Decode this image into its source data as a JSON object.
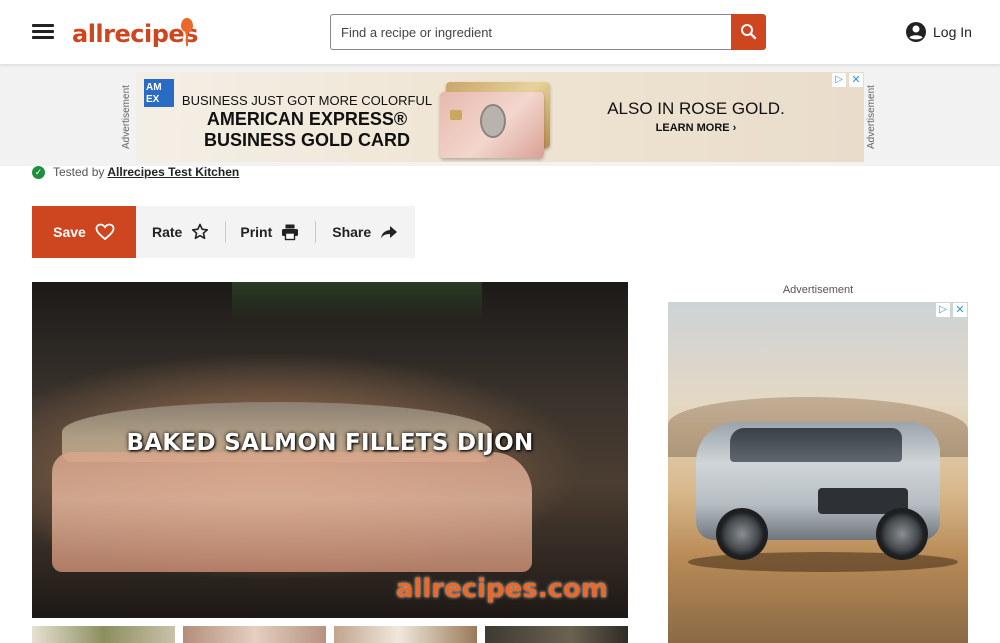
{
  "header": {
    "logo_text": "allrecipes",
    "search_placeholder": "Find a recipe or ingredient",
    "login_label": "Log In"
  },
  "ads": {
    "vertical_label": "Advertisement",
    "top": {
      "brand_logo": "AM EX",
      "headline_small": "BUSINESS JUST GOT MORE COLORFUL",
      "headline_large": "AMERICAN EXPRESS® BUSINESS GOLD CARD",
      "cta_small": "ALSO IN ROSE GOLD.",
      "cta_large": "LEARN MORE ›"
    },
    "right_label": "Advertisement"
  },
  "byline": {
    "tested_prefix": "Tested by",
    "tested_by": "Allrecipes Test Kitchen"
  },
  "actions": {
    "save": "Save",
    "rate": "Rate",
    "print": "Print",
    "share": "Share"
  },
  "video": {
    "title": "BAKED SALMON FILLETS DIJON",
    "watermark": "allrecipes.com"
  },
  "colors": {
    "brand": "#ce4620",
    "verified": "#1e8f3a"
  }
}
